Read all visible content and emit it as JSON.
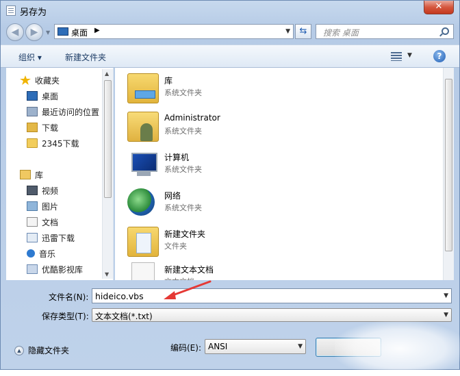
{
  "window": {
    "title": "另存为",
    "close_label": "✕"
  },
  "nav": {
    "back_glyph": "◀",
    "forward_glyph": "▶",
    "address": "桌面",
    "address_separator": "▶",
    "search_placeholder": "搜索 桌面"
  },
  "toolbar": {
    "organize": "组织 ▾",
    "new_folder": "新建文件夹",
    "help": "?"
  },
  "sidebar": {
    "favorites": "收藏夹",
    "items": [
      {
        "label": "桌面",
        "icon": "desktop-icon"
      },
      {
        "label": "最近访问的位置",
        "icon": "recent-places-icon"
      },
      {
        "label": "下载",
        "icon": "downloads-icon"
      },
      {
        "label": "2345下载",
        "icon": "folder-icon"
      }
    ],
    "libraries": "库",
    "library_items": [
      {
        "label": "视频",
        "icon": "video-icon"
      },
      {
        "label": "图片",
        "icon": "pictures-icon"
      },
      {
        "label": "文档",
        "icon": "documents-icon"
      },
      {
        "label": "迅雷下载",
        "icon": "thunder-download-icon"
      },
      {
        "label": "音乐",
        "icon": "music-icon"
      },
      {
        "label": "优酷影视库",
        "icon": "youku-icon"
      }
    ]
  },
  "files": [
    {
      "name": "库",
      "type": "系统文件夹",
      "icon": "library-icon"
    },
    {
      "name": "Administrator",
      "type": "系统文件夹",
      "icon": "user-folder-icon"
    },
    {
      "name": "计算机",
      "type": "系统文件夹",
      "icon": "computer-icon"
    },
    {
      "name": "网络",
      "type": "系统文件夹",
      "icon": "network-icon"
    },
    {
      "name": "新建文件夹",
      "type": "文件夹",
      "icon": "folder-icon"
    },
    {
      "name": "新建文本文档",
      "type": "文本文档",
      "icon": "text-document-icon"
    }
  ],
  "form": {
    "filename_label": "文件名(N):",
    "filename_value": "hideico.vbs",
    "filetype_label": "保存类型(T):",
    "filetype_value": "文本文档(*.txt)",
    "hide_folders": "隐藏文件夹",
    "encoding_label": "编码(E):",
    "encoding_value": "ANSI"
  },
  "colors": {
    "annotation_arrow": "#e53935",
    "close_button": "#d5573e",
    "accent": "#1e5bb0"
  }
}
